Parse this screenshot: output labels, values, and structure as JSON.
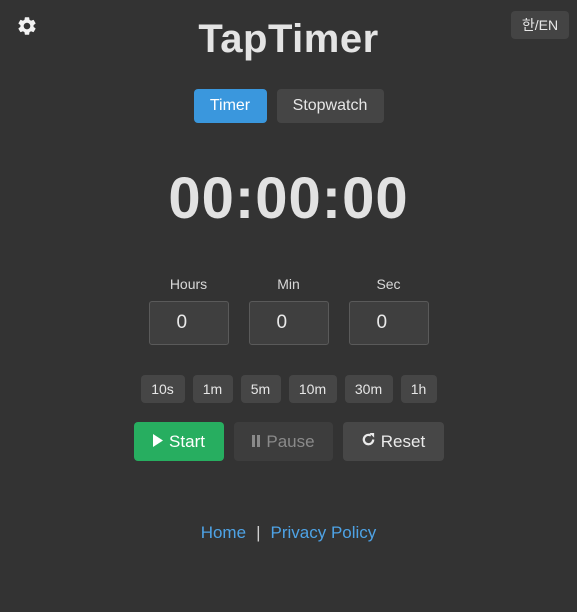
{
  "header": {
    "settings_icon": "gear-icon",
    "lang_toggle": "한/EN",
    "title": "TapTimer"
  },
  "modes": [
    {
      "label": "Timer",
      "active": true
    },
    {
      "label": "Stopwatch",
      "active": false
    }
  ],
  "display": {
    "time": "00:00:00"
  },
  "inputs": {
    "hours": {
      "label": "Hours",
      "value": "0"
    },
    "minutes": {
      "label": "Min",
      "value": "0"
    },
    "seconds": {
      "label": "Sec",
      "value": "0"
    }
  },
  "presets": [
    "10s",
    "1m",
    "5m",
    "10m",
    "30m",
    "1h"
  ],
  "controls": {
    "start": {
      "label": "Start",
      "icon": "play-icon"
    },
    "pause": {
      "label": "Pause",
      "icon": "pause-icon",
      "disabled": true
    },
    "reset": {
      "label": "Reset",
      "icon": "reset-icon"
    }
  },
  "footer": {
    "home": "Home",
    "separator": "|",
    "privacy": "Privacy Policy"
  },
  "colors": {
    "background": "#333333",
    "accent_blue": "#3a97dd",
    "start_green": "#27ae60",
    "link_blue": "#4ea3e6"
  }
}
